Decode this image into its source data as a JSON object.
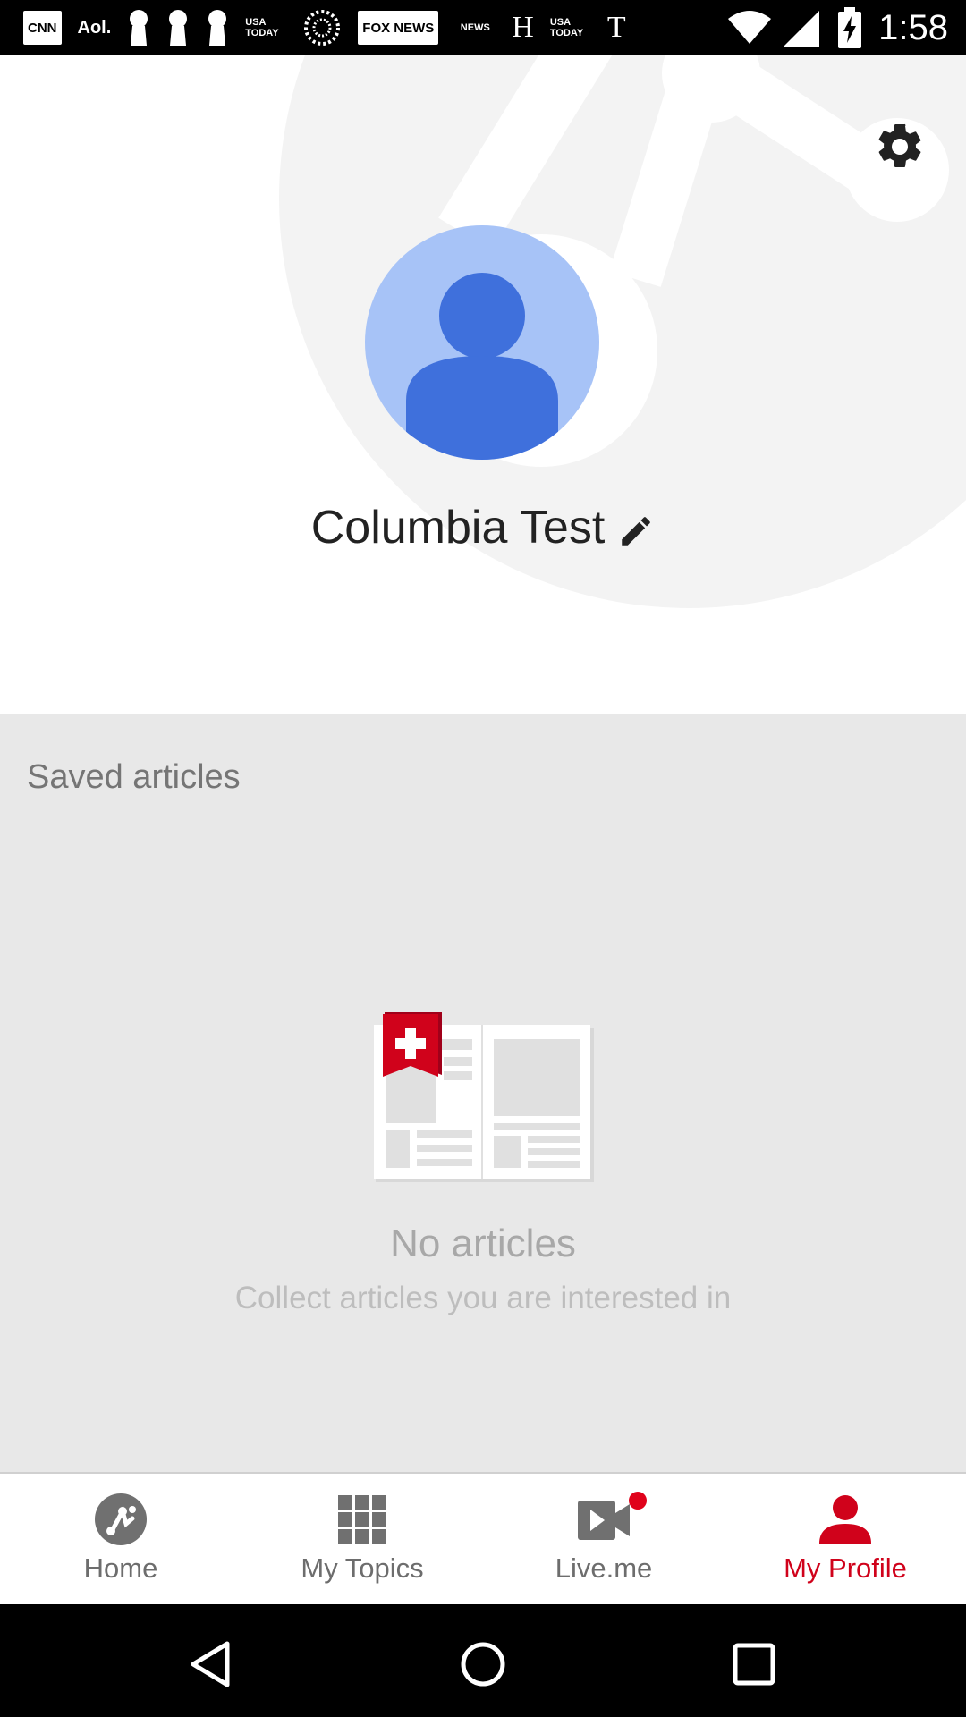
{
  "status_bar": {
    "notification_icons": [
      {
        "name": "cnn-icon",
        "text": "CNN",
        "style": "box"
      },
      {
        "name": "aol-icon",
        "text": "Aol.",
        "style": "txt"
      },
      {
        "name": "keyhole-icon",
        "text": "",
        "style": "keyhole"
      },
      {
        "name": "keyhole-icon",
        "text": "",
        "style": "keyhole"
      },
      {
        "name": "keyhole-icon",
        "text": "",
        "style": "keyhole"
      },
      {
        "name": "usa-today-icon",
        "text": "USA TODAY",
        "style": "small"
      },
      {
        "name": "sunburst-icon",
        "text": "",
        "style": "sun"
      },
      {
        "name": "fox-news-icon",
        "text": "FOX NEWS",
        "style": "box"
      },
      {
        "name": "nbc-news-icon",
        "text": "NEWS",
        "style": "small"
      },
      {
        "name": "h-icon",
        "text": "H",
        "style": "serif"
      },
      {
        "name": "usa-today-icon",
        "text": "USA TODAY",
        "style": "small"
      },
      {
        "name": "nyt-icon",
        "text": "T",
        "style": "serif"
      }
    ],
    "time": "1:58"
  },
  "profile": {
    "username": "Columbia Test"
  },
  "saved": {
    "title": "Saved articles",
    "empty_title": "No articles",
    "empty_subtitle": "Collect articles you are interested in"
  },
  "bottom_nav": {
    "items": [
      {
        "label": "Home",
        "icon": "home-icon"
      },
      {
        "label": "My Topics",
        "icon": "grid-icon"
      },
      {
        "label": "Live.me",
        "icon": "video-icon"
      },
      {
        "label": "My Profile",
        "icon": "person-icon"
      }
    ],
    "active_index": 3
  },
  "colors": {
    "accent": "#d0021b",
    "inactive": "#6d6d6d",
    "saved_bg": "#e8e8e8",
    "avatar_bg": "#a7c3f7",
    "avatar_fg": "#3c6fdc"
  }
}
